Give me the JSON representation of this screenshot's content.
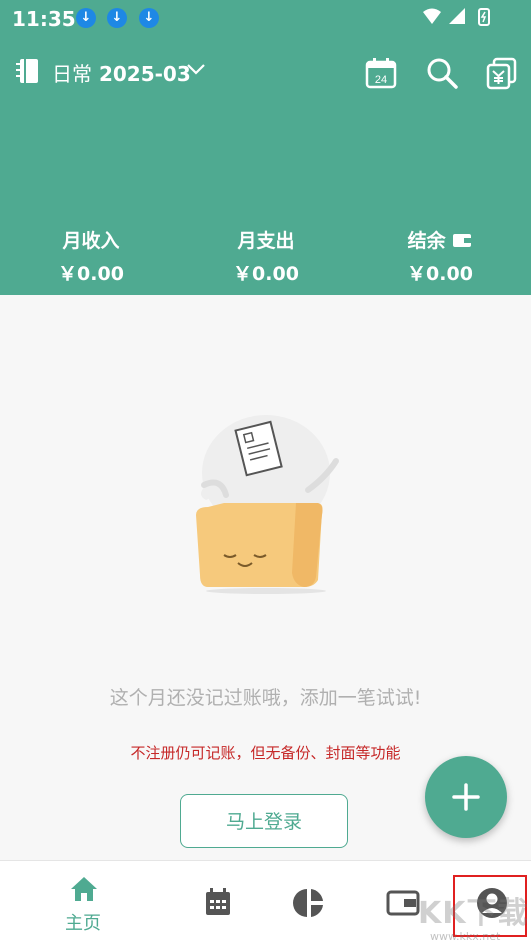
{
  "status_bar": {
    "time": "11:35",
    "download_icons": [
      "download-icon",
      "download-icon",
      "download-icon"
    ]
  },
  "header": {
    "ledger_name": "日常",
    "month": "2025-03",
    "calendar_badge": "24",
    "tools": [
      "calendar-icon",
      "search-icon",
      "bill-icon"
    ]
  },
  "summary": {
    "income_label": "月收入",
    "income_value": "￥0.00",
    "expense_label": "月支出",
    "expense_value": "￥0.00",
    "balance_label": "结余",
    "balance_value": "￥0.00"
  },
  "empty_state": {
    "message": "这个月还没记过账哦，添加一笔试试!",
    "warning": "不注册仍可记账，但无备份、封面等功能",
    "login_button": "马上登录"
  },
  "nav": {
    "items": [
      {
        "icon": "home-icon",
        "label": "主页",
        "active": true
      },
      {
        "icon": "calendar-icon",
        "label": ""
      },
      {
        "icon": "chart-pie-icon",
        "label": ""
      },
      {
        "icon": "wallet-icon",
        "label": ""
      },
      {
        "icon": "profile-icon",
        "label": ""
      }
    ]
  },
  "colors": {
    "primary": "#4faa91",
    "warning": "#c62828",
    "muted": "#b0b0b0"
  },
  "watermark": {
    "text": "KK下载",
    "url": "www.kkx.net"
  }
}
